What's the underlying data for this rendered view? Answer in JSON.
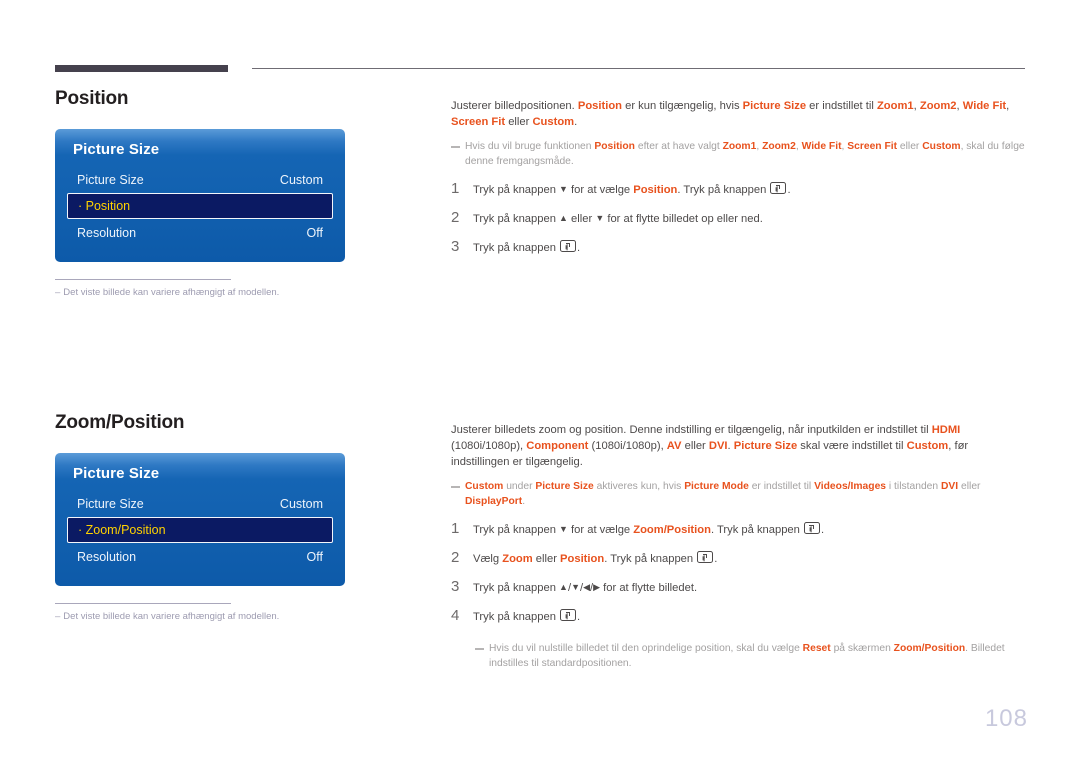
{
  "page": {
    "number": "108"
  },
  "sections": [
    {
      "heading": "Position",
      "osd": {
        "title": "Picture Size",
        "rows": [
          {
            "label": "Picture Size",
            "value": "Custom",
            "selected": false,
            "sub": false
          },
          {
            "label": "Position",
            "value": "",
            "selected": true,
            "sub": true
          },
          {
            "label": "Resolution",
            "value": "Off",
            "selected": false,
            "sub": false
          }
        ]
      },
      "footnote": "Det viste billede kan variere afhængigt af modellen.",
      "body": "Justerer billedpositionen. <b>Position</b> er kun tilgængelig, hvis <b>Picture Size</b> er indstillet til <b>Zoom1</b>, <b>Zoom2</b>, <b>Wide Fit</b>, <b>Screen Fit</b> eller <b>Custom</b>.",
      "note": "Hvis du vil bruge funktionen <b>Position</b> efter at have valgt <b>Zoom1</b>, <b>Zoom2</b>, <b>Wide Fit</b>, <b>Screen Fit</b> eller <b>Custom</b>, skal du følge denne fremgangsmåde.",
      "steps": [
        {
          "num": "1",
          "text": "Tryk på knappen <span class=\"arrow\">▼</span> for at vælge <b>Position</b>. Tryk på knappen <span class=\"enter-key\"></span>."
        },
        {
          "num": "2",
          "text": "Tryk på knappen <span class=\"arrow\">▲</span> eller <span class=\"arrow\">▼</span> for at flytte billedet op eller ned."
        },
        {
          "num": "3",
          "text": "Tryk på knappen <span class=\"enter-key\"></span>."
        }
      ],
      "trailing_note": ""
    },
    {
      "heading": "Zoom/Position",
      "osd": {
        "title": "Picture Size",
        "rows": [
          {
            "label": "Picture Size",
            "value": "Custom",
            "selected": false,
            "sub": false
          },
          {
            "label": "Zoom/Position",
            "value": "",
            "selected": true,
            "sub": true
          },
          {
            "label": "Resolution",
            "value": "Off",
            "selected": false,
            "sub": false
          }
        ]
      },
      "footnote": "Det viste billede kan variere afhængigt af modellen.",
      "body": "Justerer billedets zoom og position. Denne indstilling er tilgængelig, når inputkilden er indstillet til <b>HDMI</b> (1080i/1080p), <b>Component</b> (1080i/1080p), <b>AV</b> eller <b>DVI</b>. <b>Picture Size</b> skal være indstillet til <b>Custom</b>, før indstillingen er tilgængelig.",
      "note": "<b>Custom</b> under <b>Picture Size</b> aktiveres kun, hvis <b>Picture Mode</b> er indstillet til <b>Videos/Images</b> i tilstanden <b>DVI</b> eller <b>DisplayPort</b>.",
      "steps": [
        {
          "num": "1",
          "text": "Tryk på knappen <span class=\"arrow\">▼</span> for at vælge <b>Zoom/Position</b>. Tryk på knappen <span class=\"enter-key\"></span>."
        },
        {
          "num": "2",
          "text": "Vælg <b>Zoom</b> eller <b>Position</b>. Tryk på knappen <span class=\"enter-key\"></span>."
        },
        {
          "num": "3",
          "text": "Tryk på knappen <span class=\"arrow\">▲</span>/<span class=\"arrow\">▼</span>/<span class=\"arrow\">◀</span>/<span class=\"arrow\">▶</span> for at flytte billedet."
        },
        {
          "num": "4",
          "text": "Tryk på knappen <span class=\"enter-key\"></span>."
        }
      ],
      "trailing_note": "Hvis du vil nulstille billedet til den oprindelige position, skal du vælge <b>Reset</b> på skærmen <b>Zoom/Position</b>. Billedet indstilles til standardpositionen."
    }
  ],
  "colors": {
    "accent": "#e8521e",
    "osd_blue": "#1565b4",
    "osd_selected": "#0b1a63",
    "osd_highlight_text": "#ffd200",
    "rule_dark": "#45414d",
    "page_number": "#c8c9dd"
  }
}
